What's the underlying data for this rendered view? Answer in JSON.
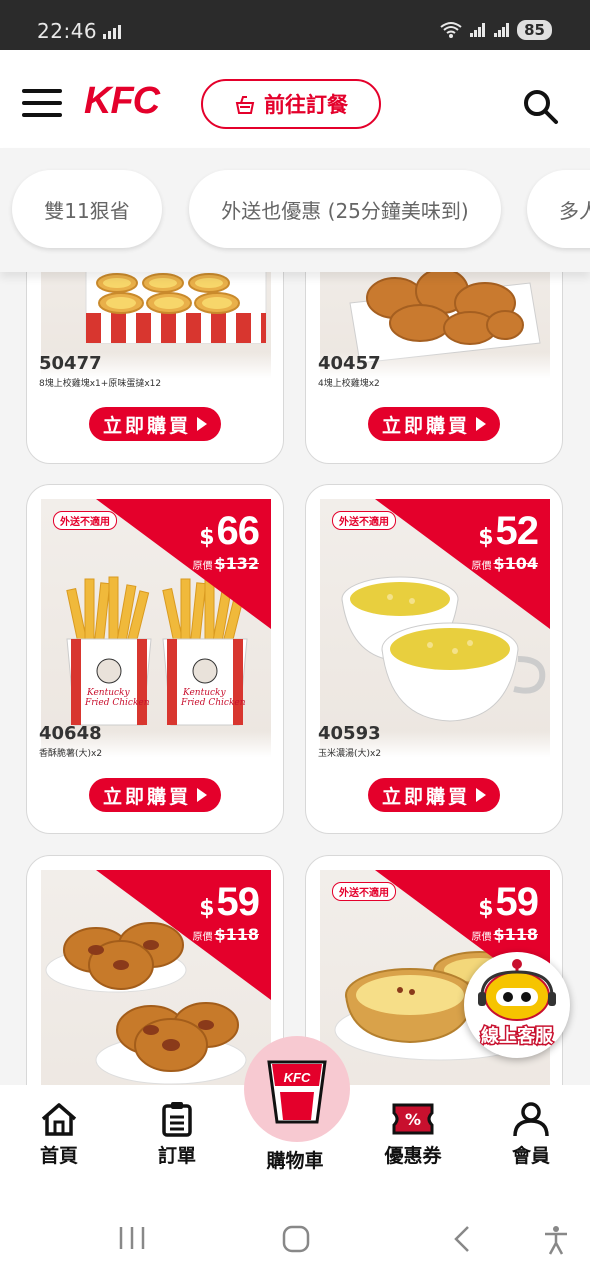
{
  "status_bar": {
    "time": "22:46",
    "battery": "85"
  },
  "header": {
    "brand": "KFC",
    "order_button": "前往訂餐"
  },
  "categories": [
    "雙11狠省",
    "外送也優惠 (25分鐘美味到)",
    "多人"
  ],
  "products": [
    {
      "code": "50477",
      "desc": "8塊上校雞塊x1+原味蛋撻x12",
      "button": "立即購買"
    },
    {
      "code": "40457",
      "desc": "4塊上校雞塊x2",
      "button": "立即購買"
    },
    {
      "code": "40648",
      "desc": "香酥脆薯(大)x2",
      "button": "立即購買",
      "tag": "外送不適用",
      "currency": "$",
      "price": "66",
      "orig_label": "原價",
      "orig_price": "$132"
    },
    {
      "code": "40593",
      "desc": "玉米濃湯(大)x2",
      "button": "立即購買",
      "tag": "外送不適用",
      "currency": "$",
      "price": "52",
      "orig_label": "原價",
      "orig_price": "$104"
    },
    {
      "currency": "$",
      "price": "59",
      "orig_label": "原價",
      "orig_price": "$118"
    },
    {
      "tag": "外送不適用",
      "currency": "$",
      "price": "59",
      "orig_label": "原價",
      "orig_price": "$118"
    }
  ],
  "chat": {
    "label": "線上客服"
  },
  "bottom_nav": {
    "home": "首頁",
    "orders": "訂單",
    "cart": "購物車",
    "coupons": "優惠券",
    "member": "會員",
    "cart_logo": "KFC"
  },
  "colors": {
    "brand_red": "#e4002b",
    "cart_pink": "#f7c9d1"
  }
}
